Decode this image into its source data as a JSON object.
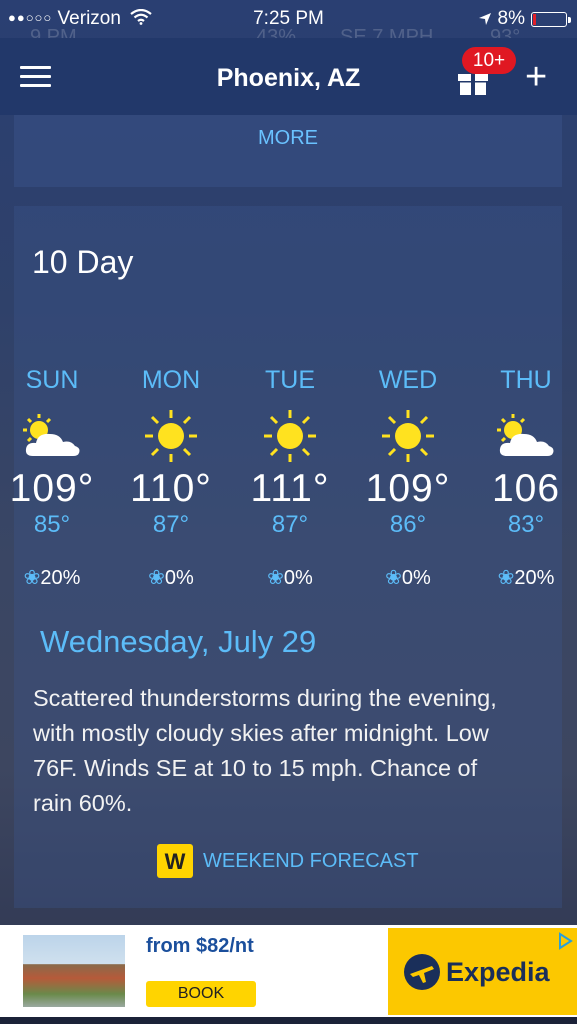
{
  "status_bar": {
    "signal_dots": "●●○○○",
    "carrier": "Verizon",
    "time": "7:25 PM",
    "battery": "8%",
    "icons": [
      "wifi-icon",
      "location-arrow-icon",
      "battery-icon"
    ]
  },
  "ghost_row": {
    "time": "9 PM",
    "humidity": "43%",
    "wind": "SE 7 MPH",
    "temp": "93°"
  },
  "navbar": {
    "title": "Phoenix, AZ",
    "badge": "10+",
    "plus": "+"
  },
  "more_card": {
    "label": "MORE"
  },
  "ten_day": {
    "title": "10 Day",
    "days": [
      {
        "name": "SUN",
        "icon": "partly-cloudy-icon",
        "high": "109°",
        "low": "85°",
        "precip": "20%"
      },
      {
        "name": "MON",
        "icon": "sunny-icon",
        "high": "110°",
        "low": "87°",
        "precip": "0%"
      },
      {
        "name": "TUE",
        "icon": "sunny-icon",
        "high": "111°",
        "low": "87°",
        "precip": "0%"
      },
      {
        "name": "WED",
        "icon": "sunny-icon",
        "high": "109°",
        "low": "86°",
        "precip": "0%"
      },
      {
        "name": "THU",
        "icon": "partly-cloudy-icon",
        "high": "106",
        "low": "83°",
        "precip": "20%"
      }
    ],
    "detail": {
      "date": "Wednesday, July 29",
      "text": "Scattered thunderstorms during the evening, with mostly cloudy skies after midnight. Low 76F. Winds SE at 10 to 15 mph. Chance of rain 60%."
    },
    "weekend_label": "WEEKEND FORECAST",
    "weekend_icon_letter": "W"
  },
  "ad": {
    "price": "from $82/nt",
    "book": "BOOK",
    "brand": "Expedia"
  },
  "colors": {
    "accent": "#5cbcf8",
    "nav": "#22386a",
    "badge": "#e01822",
    "sun": "#ffe21f",
    "ad_yellow": "#fcc800"
  }
}
